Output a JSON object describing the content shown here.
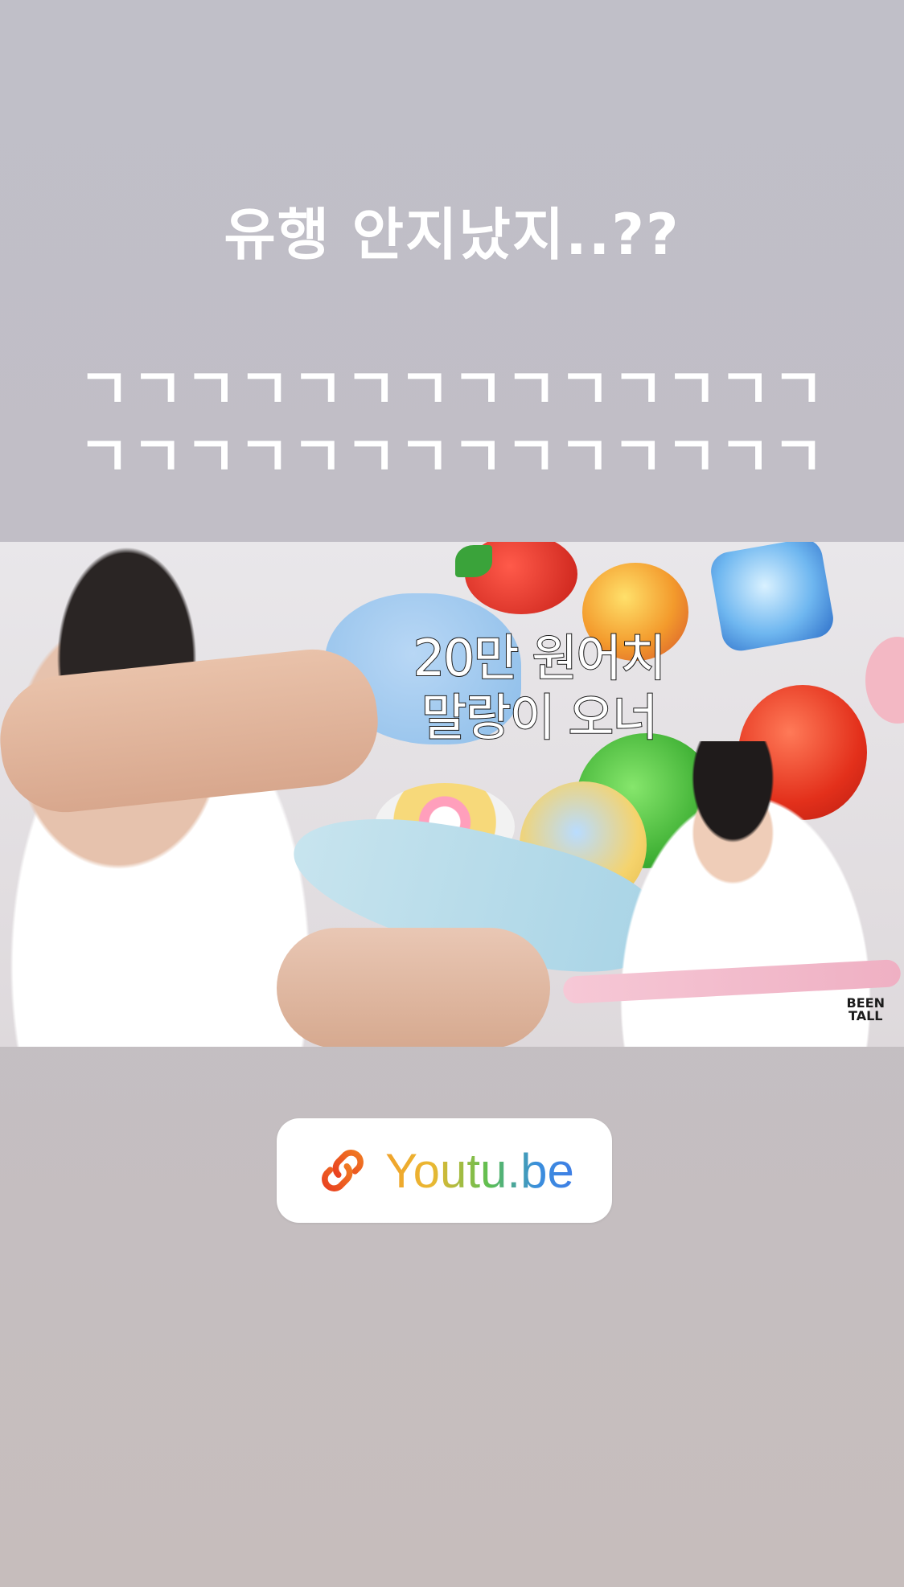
{
  "story": {
    "headline": "유행 안지났지..??",
    "laugh_line_1": "ㄱㄱㄱㄱㄱㄱㄱㄱㄱㄱㄱㄱㄱㄱ",
    "laugh_line_2": "ㄱㄱㄱㄱㄱㄱㄱㄱㄱㄱㄱㄱㄱㄱ"
  },
  "thumbnail": {
    "caption_line_1": "20만 원어치",
    "caption_line_2": "말랑이 오너",
    "logo_text_1": "BEEN",
    "logo_text_2": "TALL"
  },
  "link_sticker": {
    "label": "Youtu.be",
    "icon": "link-icon",
    "icon_color": "#e8531f"
  }
}
